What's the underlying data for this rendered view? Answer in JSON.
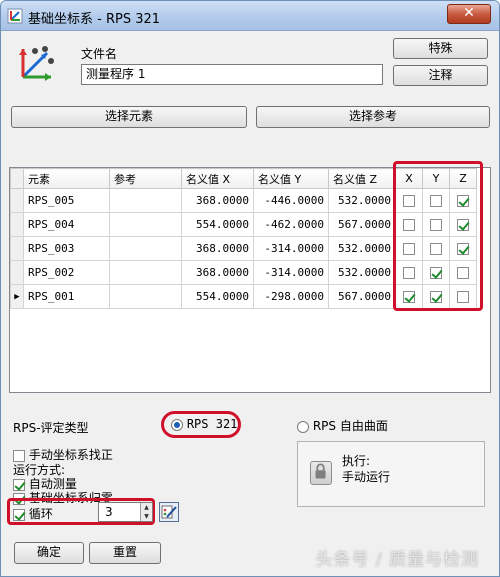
{
  "window": {
    "title": "基础坐标系 - RPS 321",
    "close_glyph": "✕"
  },
  "file": {
    "label": "文件名",
    "value": "测量程序 1"
  },
  "buttons": {
    "special": "特殊",
    "comment": "注释",
    "select_elements": "选择元素",
    "select_reference": "选择参考",
    "ok": "确定",
    "reset": "重置"
  },
  "table": {
    "headers": [
      "元素",
      "参考",
      "名义值 X",
      "名义值 Y",
      "名义值 Z",
      "X",
      "Y",
      "Z"
    ],
    "rows": [
      {
        "element": "RPS_005",
        "reference": "",
        "x": "368.0000",
        "y": "-446.0000",
        "z": "532.0000",
        "cx": false,
        "cy": false,
        "cz": true,
        "current": false
      },
      {
        "element": "RPS_004",
        "reference": "",
        "x": "554.0000",
        "y": "-462.0000",
        "z": "567.0000",
        "cx": false,
        "cy": false,
        "cz": true,
        "current": false
      },
      {
        "element": "RPS_003",
        "reference": "",
        "x": "368.0000",
        "y": "-314.0000",
        "z": "532.0000",
        "cx": false,
        "cy": false,
        "cz": true,
        "current": false
      },
      {
        "element": "RPS_002",
        "reference": "",
        "x": "368.0000",
        "y": "-314.0000",
        "z": "532.0000",
        "cx": false,
        "cy": true,
        "cz": false,
        "current": false
      },
      {
        "element": "RPS_001",
        "reference": "",
        "x": "554.0000",
        "y": "-298.0000",
        "z": "567.0000",
        "cx": true,
        "cy": true,
        "cz": false,
        "current": true
      }
    ],
    "current_row_marker": "▶"
  },
  "eval": {
    "label": "RPS-评定类型",
    "option_321": "RPS 321",
    "option_freeform": "RPS 自由曲面",
    "selected": "RPS 321"
  },
  "options": {
    "manual_align": {
      "label": "手动坐标系找正",
      "checked": false
    },
    "run_mode_label": "运行方式:",
    "auto_measure": {
      "label": "自动测量",
      "checked": true
    },
    "reset_base": {
      "label": "基础坐标系归零",
      "checked": true
    },
    "loop": {
      "label": "循环",
      "checked": true,
      "value": "3"
    }
  },
  "execute": {
    "label": "执行:",
    "value": "手动运行"
  },
  "watermark": "头条号 / 质量与检测",
  "colors": {
    "highlight": "#d0102b",
    "check": "#1f8a2e",
    "title_bar": "#b3ccec"
  }
}
